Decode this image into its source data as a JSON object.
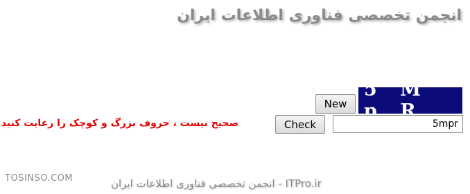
{
  "header": {
    "site_title": "انجمن تخصصی فناوری اطلاعات ایران"
  },
  "captcha": {
    "code_text": "5 M p R",
    "new_label": "New",
    "check_label": "Check",
    "input_value": "5mpr",
    "box_color": "#0b0b7a"
  },
  "error": {
    "message": "صحیح نیست ، حروف بزرگ و کوچک را رعایت کنید",
    "color": "#e00000"
  },
  "footer": {
    "left_text": "TOSINSO.COM",
    "right_text": "ITPro.ir - انجمن تخصصی فناوری اطلاعات ایران"
  }
}
